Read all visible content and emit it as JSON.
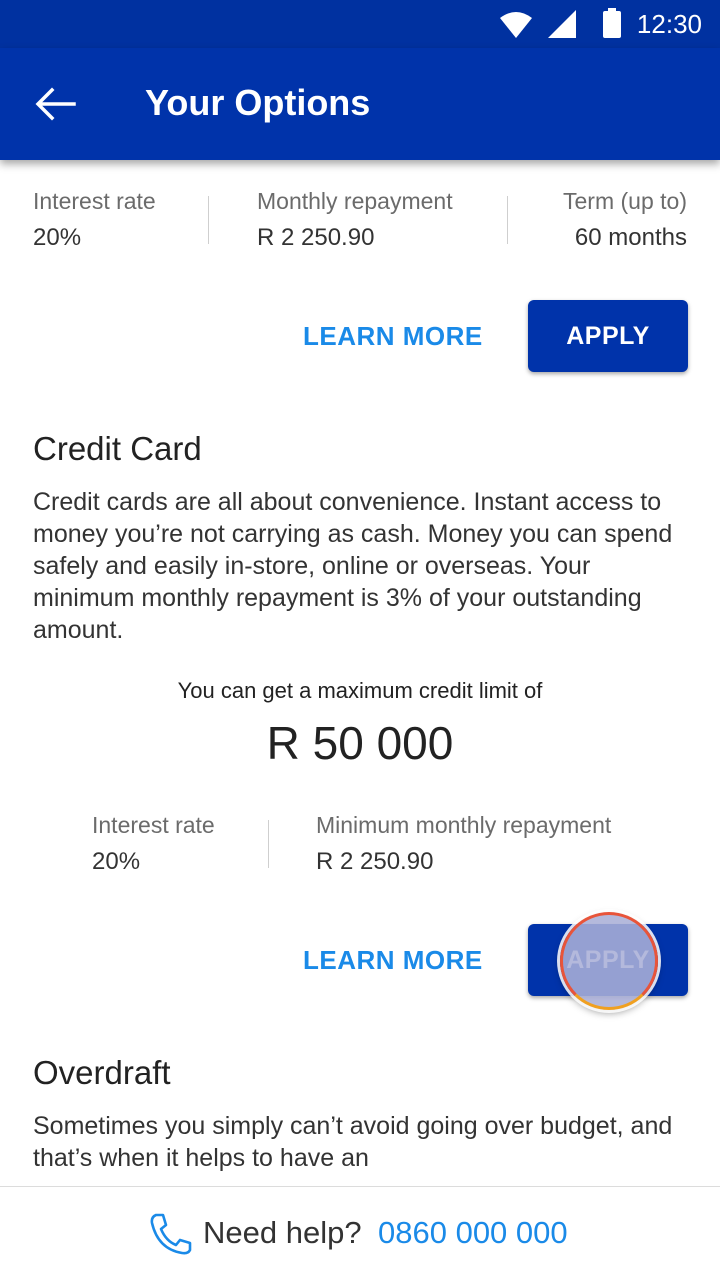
{
  "status_bar": {
    "time": "12:30",
    "icons": [
      "wifi-icon",
      "signal-icon",
      "battery-icon"
    ]
  },
  "app_bar": {
    "back_icon": "arrow-left-icon",
    "title": "Your Options"
  },
  "loan_summary": {
    "interest_rate_label": "Interest rate",
    "interest_rate_value": "20%",
    "monthly_repayment_label": "Monthly repayment",
    "monthly_repayment_value": "R 2 250.90",
    "term_label": "Term (up to)",
    "term_value": "60 months",
    "learn_more_label": "LEARN MORE",
    "apply_label": "APPLY"
  },
  "credit_card": {
    "title": "Credit Card",
    "description": "Credit cards are all about convenience. Instant access to money you’re not carrying as cash. Money you can spend safely and easily in-store, online or overseas. Your minimum monthly repayment is 3% of your outstanding amount.",
    "limit_caption": "You can get a maximum credit limit of",
    "limit_amount": "R 50 000",
    "interest_rate_label": "Interest rate",
    "interest_rate_value": "20%",
    "min_repayment_label": "Minimum monthly repayment",
    "min_repayment_value": "R 2 250.90",
    "learn_more_label": "LEARN MORE",
    "apply_label": "APPLY"
  },
  "overdraft": {
    "title": "Overdraft",
    "description": "Sometimes you simply can’t avoid going over budget, and that’s when it helps to have an"
  },
  "footer": {
    "phone_icon": "phone-icon",
    "help_text": "Need help?",
    "phone_number": "0860 000 000"
  },
  "colors": {
    "primary": "#0033aa",
    "status_bar": "#0031a0",
    "link": "#1a8ae8"
  }
}
